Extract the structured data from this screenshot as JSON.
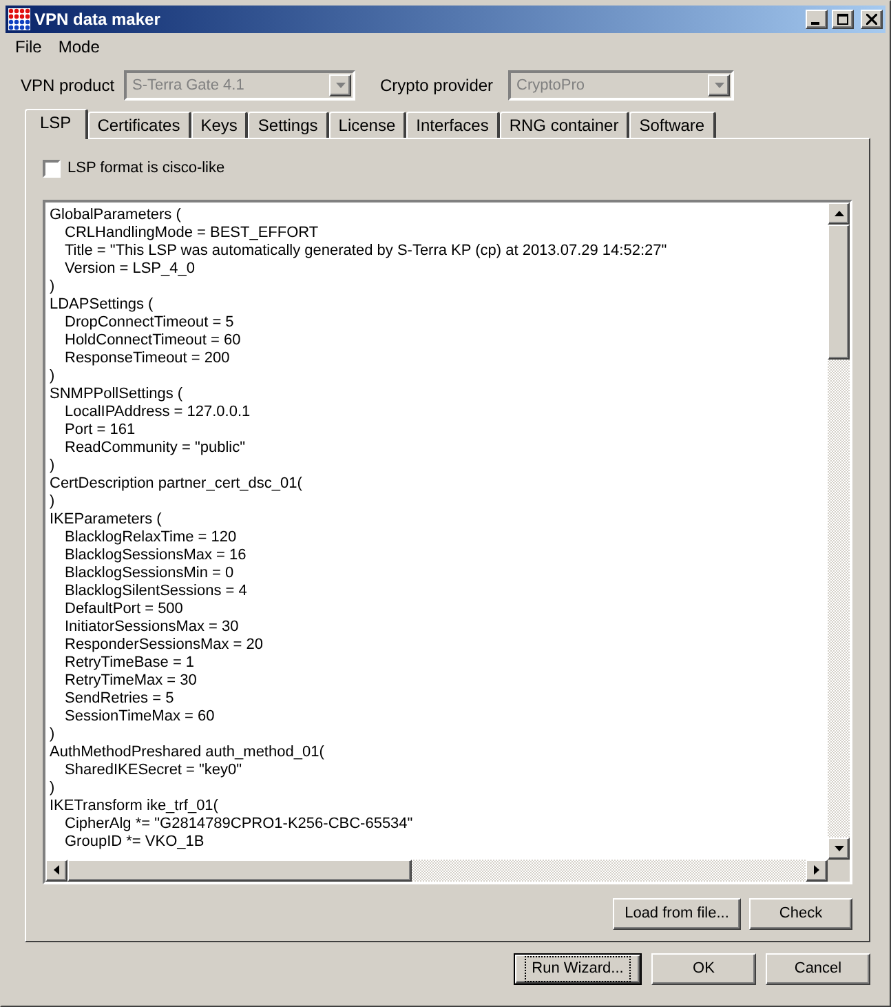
{
  "window": {
    "title": "VPN data maker"
  },
  "menu": [
    "File",
    "Mode"
  ],
  "product": {
    "label": "VPN product",
    "value": "S-Terra Gate 4.1",
    "disabled": true
  },
  "crypto": {
    "label": "Crypto provider",
    "value": "CryptoPro",
    "disabled": true
  },
  "tabs": [
    {
      "label": "LSP",
      "selected": true
    },
    {
      "label": "Certificates",
      "selected": false
    },
    {
      "label": "Keys",
      "selected": false
    },
    {
      "label": "Settings",
      "selected": false
    },
    {
      "label": "License",
      "selected": false
    },
    {
      "label": "Interfaces",
      "selected": false
    },
    {
      "label": "RNG container",
      "selected": false
    },
    {
      "label": "Software",
      "selected": false
    }
  ],
  "cisco_like": {
    "label": "LSP format is cisco-like",
    "checked": false
  },
  "lsp_text": [
    {
      "text": "GlobalParameters (",
      "children": [
        "CRLHandlingMode = BEST_EFFORT",
        "Title = \"This LSP was automatically generated by S-Terra KP (cp) at 2013.07.29 14:52:27\"",
        "Version = LSP_4_0"
      ]
    },
    {
      "text": ")"
    },
    {
      "text": "LDAPSettings (",
      "children": [
        "DropConnectTimeout = 5",
        "HoldConnectTimeout = 60",
        "ResponseTimeout = 200"
      ]
    },
    {
      "text": ")"
    },
    {
      "text": "SNMPPollSettings (",
      "children": [
        "LocalIPAddress = 127.0.0.1",
        "Port = 161",
        "ReadCommunity = \"public\""
      ]
    },
    {
      "text": ")"
    },
    {
      "text": "CertDescription partner_cert_dsc_01("
    },
    {
      "text": ")"
    },
    {
      "text": "IKEParameters (",
      "children": [
        "BlacklogRelaxTime = 120",
        "BlacklogSessionsMax = 16",
        "BlacklogSessionsMin = 0",
        "BlacklogSilentSessions = 4",
        "DefaultPort = 500",
        "InitiatorSessionsMax = 30",
        "ResponderSessionsMax = 20",
        "RetryTimeBase = 1",
        "RetryTimeMax = 30",
        "SendRetries = 5",
        "SessionTimeMax = 60"
      ]
    },
    {
      "text": ")"
    },
    {
      "text": "AuthMethodPreshared auth_method_01(",
      "children": [
        "SharedIKESecret = \"key0\""
      ]
    },
    {
      "text": ")"
    },
    {
      "text": "IKETransform ike_trf_01(",
      "children": [
        "CipherAlg *= \"G2814789CPRO1-K256-CBC-65534\"",
        "GroupID *= VKO_1B"
      ]
    }
  ],
  "panel_buttons": [
    "Load from file...",
    "Check"
  ],
  "dialog_buttons": [
    {
      "label": "Run Wizard...",
      "focused": true
    },
    {
      "label": "OK",
      "focused": false
    },
    {
      "label": "Cancel",
      "focused": false
    }
  ]
}
